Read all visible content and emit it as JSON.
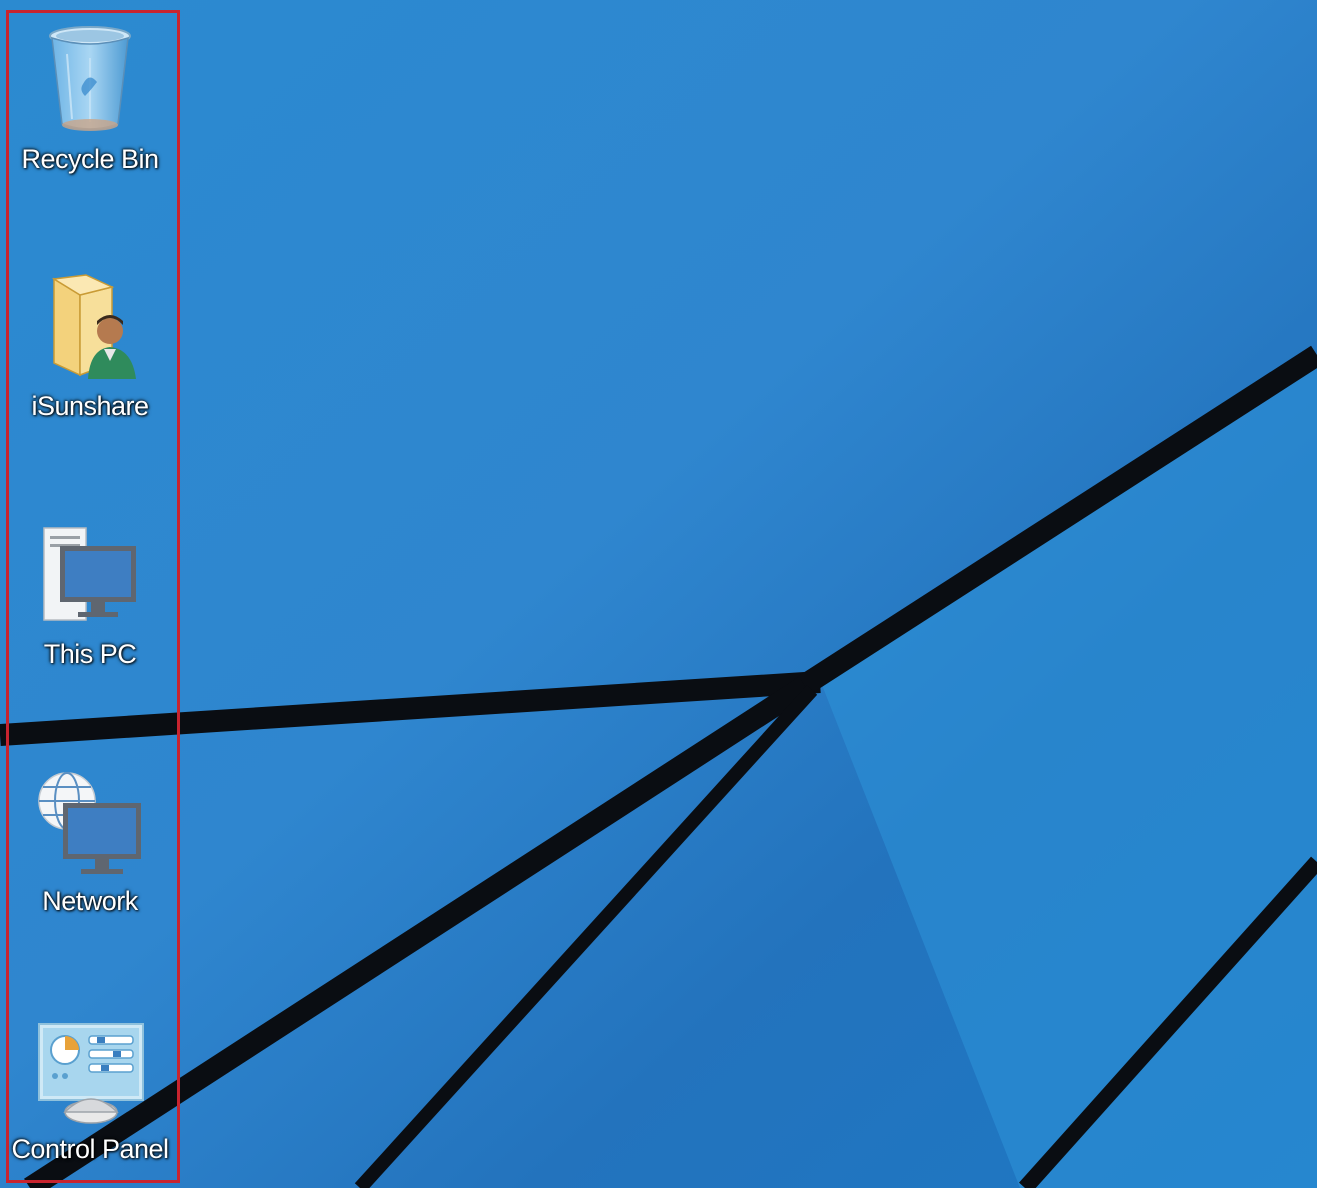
{
  "desktop": {
    "background_color": "#2a7fc8",
    "line_color": "#0a0d12",
    "highlight_color": "#c8242f",
    "icons": [
      {
        "label": "Recycle Bin",
        "icon": "recycle-bin-icon"
      },
      {
        "label": "iSunshare",
        "icon": "user-folder-icon"
      },
      {
        "label": "This PC",
        "icon": "this-pc-icon"
      },
      {
        "label": "Network",
        "icon": "network-icon"
      },
      {
        "label": "Control Panel",
        "icon": "control-panel-icon"
      }
    ]
  }
}
